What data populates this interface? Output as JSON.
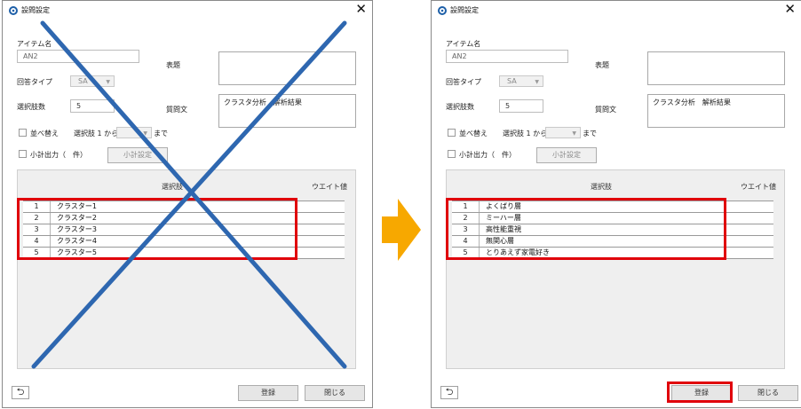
{
  "left_dialog": {
    "title": "設問設定",
    "close_glyph": "✕",
    "item_name_label": "アイテム名",
    "item_name_value": "AN2",
    "title_label": "表題",
    "answer_type_label": "回答タイプ",
    "answer_type_value": "SA",
    "choice_count_label": "選択肢数",
    "choice_count_value": "5",
    "question_label": "質問文",
    "question_value": "クラスタ分析　解析結果",
    "sort_label": "並べ替え",
    "from_label": "選択肢 1 から",
    "to_label": "まで",
    "subtotal_label": "小計出力（　件）",
    "subtotal_button": "小計設定",
    "grid_header_choice": "選択肢",
    "grid_header_weight": "ウエイト値",
    "rows": [
      {
        "num": "1",
        "text": "クラスター1"
      },
      {
        "num": "2",
        "text": "クラスター2"
      },
      {
        "num": "3",
        "text": "クラスター3"
      },
      {
        "num": "4",
        "text": "クラスター4"
      },
      {
        "num": "5",
        "text": "クラスター5"
      }
    ],
    "register_button": "登録",
    "close_button": "閉じる",
    "back_glyph": "⮌"
  },
  "right_dialog": {
    "title": "設問設定",
    "close_glyph": "✕",
    "item_name_label": "アイテム名",
    "item_name_value": "AN2",
    "title_label": "表題",
    "answer_type_label": "回答タイプ",
    "answer_type_value": "SA",
    "choice_count_label": "選択肢数",
    "choice_count_value": "5",
    "question_label": "質問文",
    "question_value": "クラスタ分析　解析結果",
    "sort_label": "並べ替え",
    "from_label": "選択肢 1 から",
    "to_label": "まで",
    "subtotal_label": "小計出力（　件）",
    "subtotal_button": "小計設定",
    "grid_header_choice": "選択肢",
    "grid_header_weight": "ウエイト値",
    "rows": [
      {
        "num": "1",
        "text": "よくばり層"
      },
      {
        "num": "2",
        "text": "ミーハー層"
      },
      {
        "num": "3",
        "text": "高性能重視"
      },
      {
        "num": "4",
        "text": "無関心層"
      },
      {
        "num": "5",
        "text": "とりあえず家電好き"
      }
    ],
    "register_button": "登録",
    "close_button": "閉じる",
    "back_glyph": "⮌"
  },
  "colors": {
    "highlight_red": "#e0000b",
    "cross_blue": "#2e67b0",
    "arrow_orange": "#f7a800",
    "icon_blue": "#1d5fa8"
  }
}
